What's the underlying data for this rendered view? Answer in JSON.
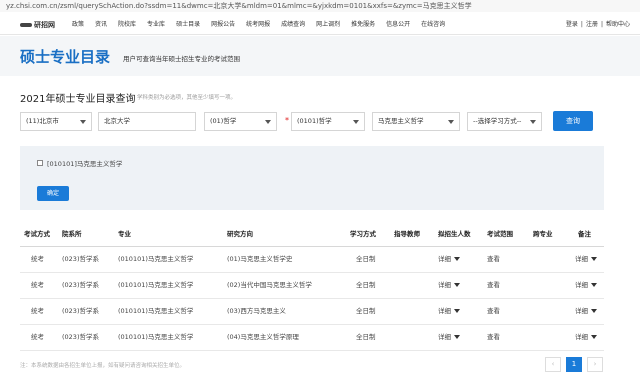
{
  "browser": {
    "url": "yz.chsi.com.cn/zsml/querySchAction.do?ssdm=11&dwmc=北京大学&mldm=01&mlmc=&yjxkdm=0101&xxfs=&zymc=马克思主义哲学"
  },
  "topnav": {
    "logo_text": "研招网",
    "items": [
      "政策",
      "资讯",
      "院校库",
      "专业库",
      "硕士目录",
      "网报公告",
      "统考网报",
      "成绩查询",
      "网上调剂",
      "推免服务",
      "信息公开",
      "在线咨询"
    ],
    "login": "登录",
    "register": "注册",
    "help": "帮助中心",
    "sep": "|"
  },
  "header": {
    "title": "硕士专业目录",
    "subtitle": "用户可查询当年硕士招生专业的考试范围"
  },
  "query": {
    "title": "2021年硕士专业目录查询",
    "hint": "学科类别为必选项，其他至少填写一项。",
    "province": "(11)北京市",
    "school": "北京大学",
    "category": "(01)哲学",
    "required_mark": "*",
    "discipline": "(0101)哲学",
    "major": "马克思主义哲学",
    "study_mode": "--选择学习方式--",
    "query_button": "查询"
  },
  "panel": {
    "checkbox_label": "[010101]马克思主义哲学",
    "confirm_button": "确定"
  },
  "table": {
    "headers": [
      "考试方式",
      "院系所",
      "专业",
      "研究方向",
      "学习方式",
      "指导教师",
      "拟招生人数",
      "考试范围",
      "跨专业",
      "备注"
    ],
    "rows": [
      [
        "统考",
        "(023)哲学系",
        "(010101)马克思主义哲学",
        "(01)马克思主义哲学史",
        "全日制",
        "",
        "详细",
        "查看",
        "",
        "详细"
      ],
      [
        "统考",
        "(023)哲学系",
        "(010101)马克思主义哲学",
        "(02)当代中国马克思主义哲学",
        "全日制",
        "",
        "详细",
        "查看",
        "",
        "详细"
      ],
      [
        "统考",
        "(023)哲学系",
        "(010101)马克思主义哲学",
        "(03)西方马克思主义",
        "全日制",
        "",
        "详细",
        "查看",
        "",
        "详细"
      ],
      [
        "统考",
        "(023)哲学系",
        "(010101)马克思主义哲学",
        "(04)马克思主义哲学原理",
        "全日制",
        "",
        "详细",
        "查看",
        "",
        "详细"
      ]
    ]
  },
  "footer": {
    "note": "注：本系统数据由各招生单位上报，如有疑问请咨询相关招生单位。"
  },
  "pagination": {
    "prev": "‹",
    "current": "1",
    "next": "›"
  },
  "colors": {
    "accent": "#1a7bd8",
    "title_blue": "#1a6fc4",
    "required": "#e02020"
  }
}
